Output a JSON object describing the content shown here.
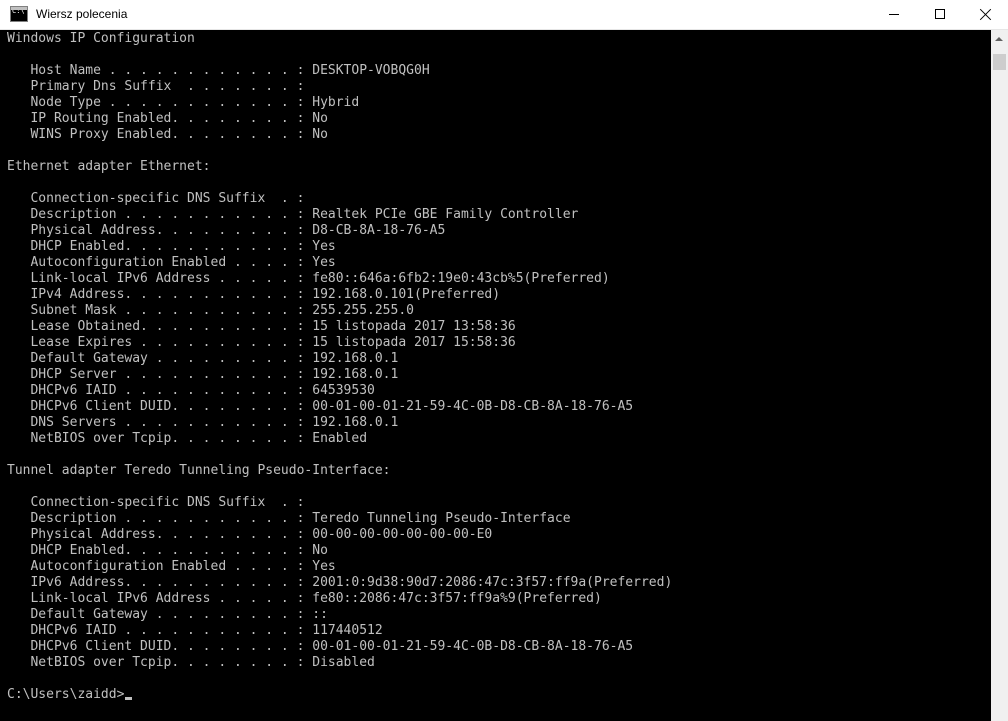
{
  "window": {
    "title": "Wiersz polecenia",
    "icon_label": "C:\\"
  },
  "console": {
    "lines": [
      "Windows IP Configuration",
      "",
      "   Host Name . . . . . . . . . . . . : DESKTOP-VOBQG0H",
      "   Primary Dns Suffix  . . . . . . . :",
      "   Node Type . . . . . . . . . . . . : Hybrid",
      "   IP Routing Enabled. . . . . . . . : No",
      "   WINS Proxy Enabled. . . . . . . . : No",
      "",
      "Ethernet adapter Ethernet:",
      "",
      "   Connection-specific DNS Suffix  . :",
      "   Description . . . . . . . . . . . : Realtek PCIe GBE Family Controller",
      "   Physical Address. . . . . . . . . : D8-CB-8A-18-76-A5",
      "   DHCP Enabled. . . . . . . . . . . : Yes",
      "   Autoconfiguration Enabled . . . . : Yes",
      "   Link-local IPv6 Address . . . . . : fe80::646a:6fb2:19e0:43cb%5(Preferred)",
      "   IPv4 Address. . . . . . . . . . . : 192.168.0.101(Preferred)",
      "   Subnet Mask . . . . . . . . . . . : 255.255.255.0",
      "   Lease Obtained. . . . . . . . . . : 15 listopada 2017 13:58:36",
      "   Lease Expires . . . . . . . . . . : 15 listopada 2017 15:58:36",
      "   Default Gateway . . . . . . . . . : 192.168.0.1",
      "   DHCP Server . . . . . . . . . . . : 192.168.0.1",
      "   DHCPv6 IAID . . . . . . . . . . . : 64539530",
      "   DHCPv6 Client DUID. . . . . . . . : 00-01-00-01-21-59-4C-0B-D8-CB-8A-18-76-A5",
      "   DNS Servers . . . . . . . . . . . : 192.168.0.1",
      "   NetBIOS over Tcpip. . . . . . . . : Enabled",
      "",
      "Tunnel adapter Teredo Tunneling Pseudo-Interface:",
      "",
      "   Connection-specific DNS Suffix  . :",
      "   Description . . . . . . . . . . . : Teredo Tunneling Pseudo-Interface",
      "   Physical Address. . . . . . . . . : 00-00-00-00-00-00-00-E0",
      "   DHCP Enabled. . . . . . . . . . . : No",
      "   Autoconfiguration Enabled . . . . : Yes",
      "   IPv6 Address. . . . . . . . . . . : 2001:0:9d38:90d7:2086:47c:3f57:ff9a(Preferred)",
      "   Link-local IPv6 Address . . . . . : fe80::2086:47c:3f57:ff9a%9(Preferred)",
      "   Default Gateway . . . . . . . . . : ::",
      "   DHCPv6 IAID . . . . . . . . . . . : 117440512",
      "   DHCPv6 Client DUID. . . . . . . . : 00-01-00-01-21-59-4C-0B-D8-CB-8A-18-76-A5",
      "   NetBIOS over Tcpip. . . . . . . . : Disabled",
      ""
    ],
    "prompt": "C:\\Users\\zaidd>"
  },
  "colors": {
    "console_background": "#000000",
    "console_text": "#c0c0c0",
    "titlebar_background": "#ffffff"
  },
  "icons": {
    "app": "cmd-icon",
    "minimize": "minimize-icon",
    "maximize": "maximize-icon",
    "close": "close-icon",
    "scroll_up": "scroll-up-arrow-icon"
  }
}
